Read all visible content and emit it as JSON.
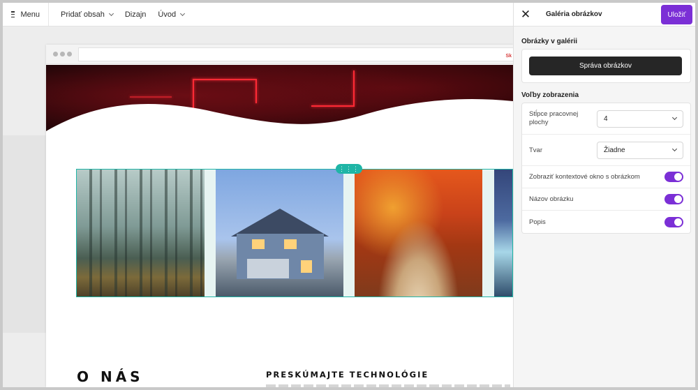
{
  "topbar": {
    "menu_label": "Menu",
    "nav": [
      "Pridať obsah",
      "Dizajn",
      "Úvod"
    ]
  },
  "preview": {
    "url_fragment": "Sk",
    "about_heading": "O NÁS",
    "explore_heading": "PRESKÚMAJTE TECHNOLÓGIE",
    "gallery_images": [
      "forest",
      "house",
      "autumn-path",
      "waterfall"
    ]
  },
  "panel": {
    "title": "Galéria obrázkov",
    "save_label": "Uložiť",
    "section_images": "Obrázky v galérii",
    "manage_label": "Správa obrázkov",
    "section_display": "Voľby zobrazenia",
    "desktop_columns_label": "Stĺpce pracovnej plochy",
    "desktop_columns_value": "4",
    "shape_label": "Tvar",
    "shape_value": "Žiadne",
    "toggles": [
      {
        "label": "Zobraziť kontextové okno s obrázkom",
        "on": true
      },
      {
        "label": "Názov obrázku",
        "on": true
      },
      {
        "label": "Popis",
        "on": true
      }
    ]
  },
  "colors": {
    "accent": "#7b2fd6",
    "selection": "#1fb5a6",
    "dark_button": "#262626"
  }
}
